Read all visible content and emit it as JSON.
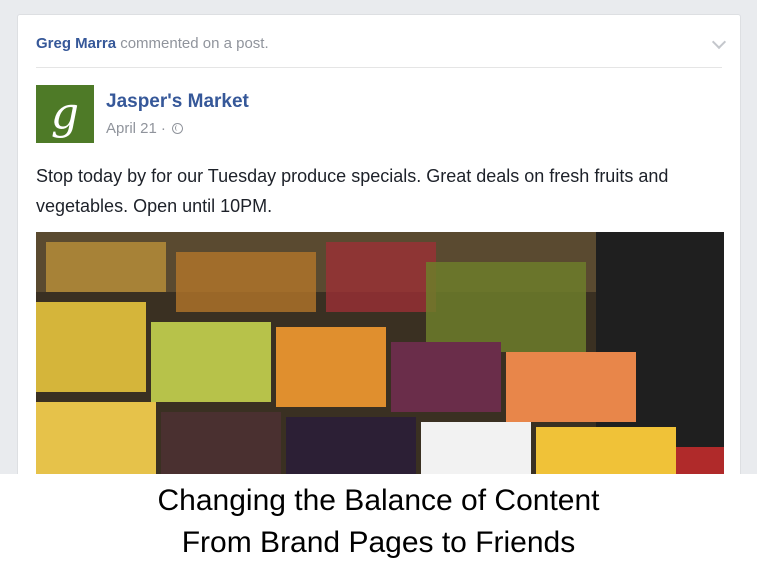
{
  "story": {
    "actor": "Greg Marra",
    "action": "commented on a post."
  },
  "post": {
    "avatar_letter": "g",
    "page_name": "Jasper's Market",
    "date": "April 21",
    "separator": "·",
    "text": "Stop today by for our Tuesday produce specials. Great deals on fresh fruits and vegetables. Open until 10PM."
  },
  "icons": [
    "chevron-down-icon",
    "globe-icon"
  ],
  "caption": {
    "line1": "Changing the Balance of Content",
    "line2": "From Brand Pages to Friends"
  },
  "colors": {
    "link_blue": "#365899",
    "meta_gray": "#90949c",
    "avatar_green": "#4e7a27"
  }
}
